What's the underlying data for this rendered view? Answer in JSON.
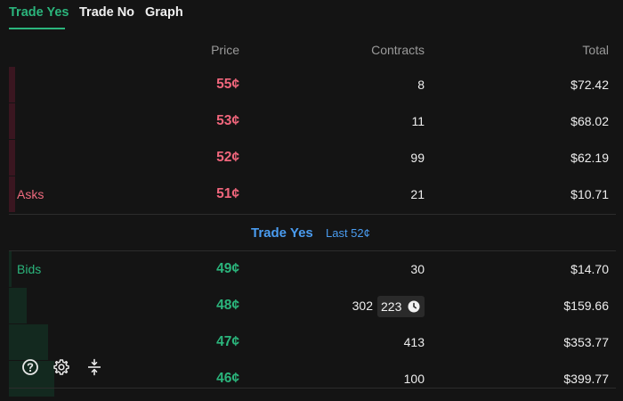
{
  "tabs": [
    "Trade Yes",
    "Trade No",
    "Graph"
  ],
  "header": {
    "price": "Price",
    "contracts": "Contracts",
    "total": "Total"
  },
  "asks_label": "Asks",
  "bids_label": "Bids",
  "asks": [
    {
      "price": "55¢",
      "contracts": "8",
      "total": "$72.42"
    },
    {
      "price": "53¢",
      "contracts": "11",
      "total": "$68.02"
    },
    {
      "price": "52¢",
      "contracts": "99",
      "total": "$62.19"
    },
    {
      "price": "51¢",
      "contracts": "21",
      "total": "$10.71"
    }
  ],
  "spread": {
    "title": "Trade Yes",
    "last": "Last 52¢"
  },
  "bids": [
    {
      "price": "49¢",
      "contracts": "30",
      "total": "$14.70"
    },
    {
      "price": "48¢",
      "contracts": "302",
      "total": "$159.66"
    },
    {
      "price": "47¢",
      "contracts": "413",
      "total": "$353.77"
    },
    {
      "price": "46¢",
      "contracts": "100",
      "total": "$399.77"
    }
  ],
  "pending_badge": {
    "value": "223",
    "icon": "clock-icon"
  },
  "tools": [
    "help-icon",
    "gear-icon",
    "compress-icon"
  ],
  "colors": {
    "accent_green": "#2bb57c",
    "ask_red": "#f0667c",
    "spread_blue": "#4a9cf0",
    "background": "#141414"
  }
}
